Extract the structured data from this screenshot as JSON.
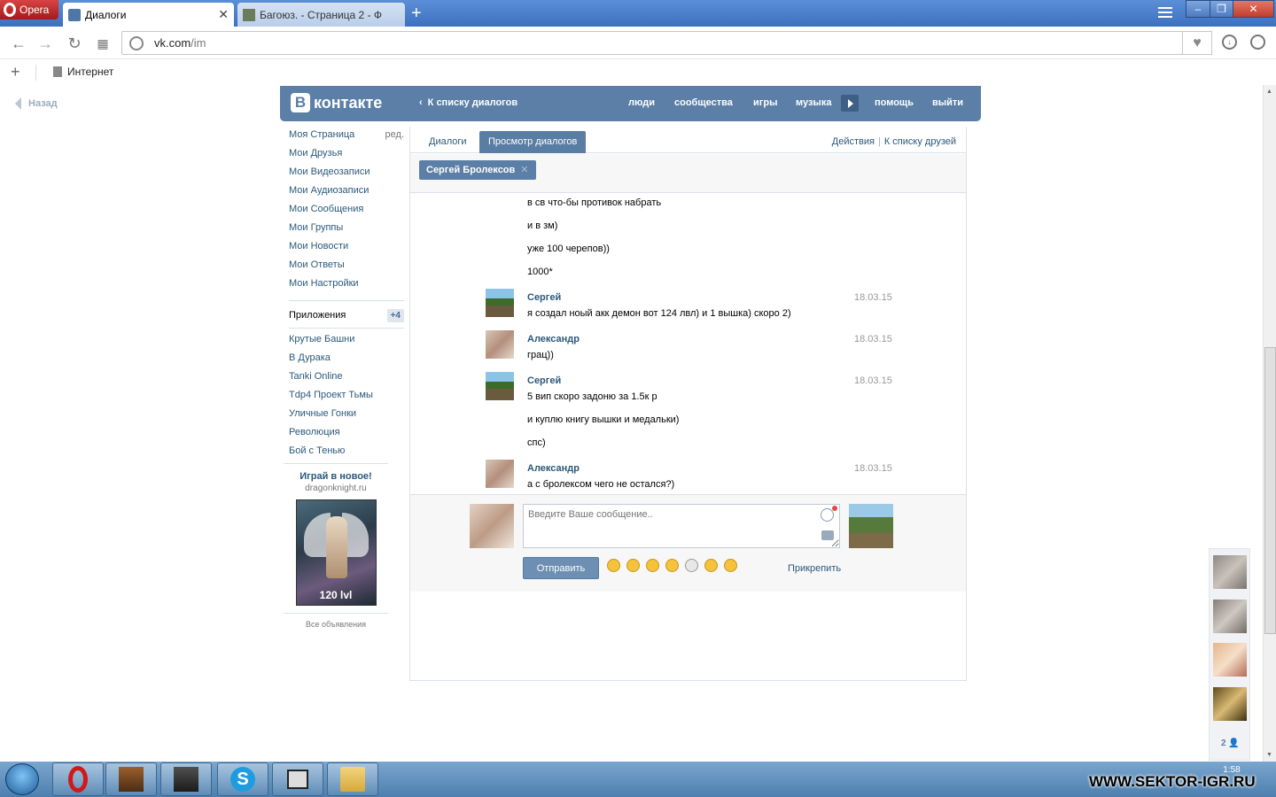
{
  "browser": {
    "app_name": "Opera",
    "tabs": [
      {
        "title": "Диалоги",
        "active": true
      },
      {
        "title": "Багоюз. - Страница 2 - Ф",
        "active": false
      }
    ],
    "url_host": "vk.com",
    "url_path": "/im",
    "bookmark": "Интернет"
  },
  "page": {
    "back_label": "Назад",
    "header": {
      "logo_text": "контакте",
      "logo_letter": "В",
      "back_to_dialogs": "К списку диалогов",
      "nav": [
        "люди",
        "сообщества",
        "игры",
        "музыка",
        "помощь",
        "выйти"
      ]
    },
    "left_menu": {
      "items": [
        "Моя Страница",
        "Мои Друзья",
        "Мои Видеозаписи",
        "Мои Аудиозаписи",
        "Мои Сообщения",
        "Мои Группы",
        "Мои Новости",
        "Мои Ответы",
        "Мои Настройки"
      ],
      "edit_label": "ред.",
      "apps_label": "Приложения",
      "apps_badge": "+4",
      "apps": [
        "Крутые Башни",
        "В Дурака",
        "Tanki Online",
        "Tdp4 Проект Тьмы",
        "Уличные Гонки",
        "Революция",
        "Бой с Тенью"
      ]
    },
    "ad": {
      "title": "Играй в новое!",
      "site": "dragonknight.ru",
      "image_caption": "120 lvl",
      "all_ads": "Все объявления"
    },
    "dialog": {
      "tabs": [
        "Диалоги",
        "Просмотр диалогов"
      ],
      "actions": "Действия",
      "friends_list": "К списку друзей",
      "chip_name": "Сергей Бролексов",
      "messages": [
        {
          "author": "",
          "date": "",
          "lines": [
            "в св что-бы противок набрать",
            "и в зм)",
            "уже 100 черепов))",
            "1000*"
          ]
        },
        {
          "author": "Сергей",
          "date": "18.03.15",
          "lines": [
            "я создал ноый акк демон вот 124 лвл) и 1 вышка) скоро 2)"
          ]
        },
        {
          "author": "Александр",
          "date": "18.03.15",
          "lines": [
            "грац))"
          ]
        },
        {
          "author": "Сергей",
          "date": "18.03.15",
          "lines": [
            "5 вип скоро задоню за 1.5к р",
            "и куплю книгу вышки и медальки)",
            "спс)"
          ]
        },
        {
          "author": "Александр",
          "date": "18.03.15",
          "lines": [
            "а с бролексом чего не остался?)"
          ]
        }
      ],
      "composer": {
        "placeholder": "Введите Ваше сообщение..",
        "send_label": "Отправить",
        "attach_label": "Прикрепить",
        "smiles": [
          "smile-1",
          "smile-2",
          "smile-3",
          "smile-4",
          "smile-5",
          "smile-6",
          "smile-7"
        ]
      }
    },
    "friends_online": {
      "count": "2"
    }
  },
  "taskbar": {
    "clock_time": "1:58",
    "watermark": "WWW.SEKTOR-IGR.RU"
  }
}
